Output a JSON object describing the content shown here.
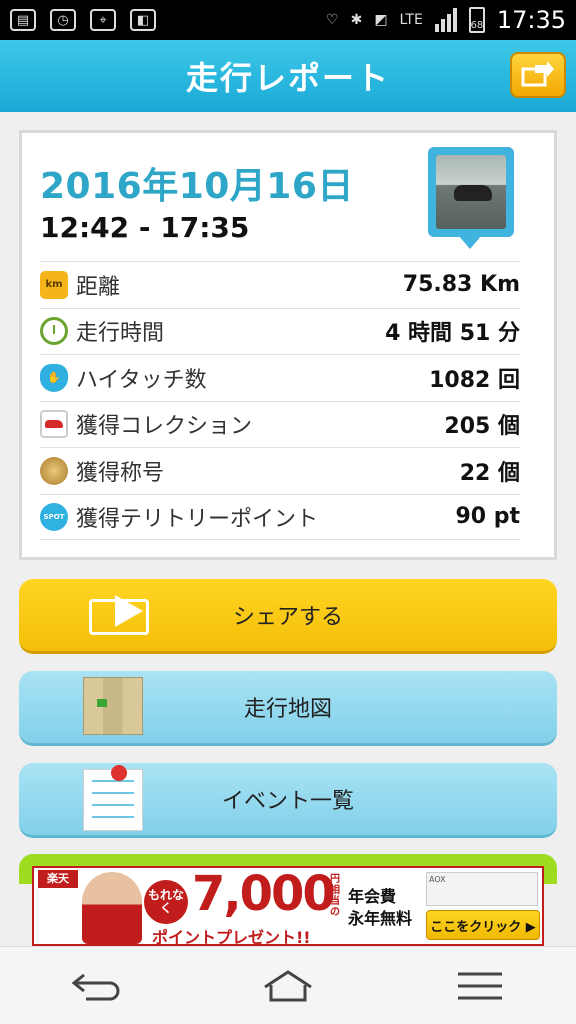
{
  "status_bar": {
    "network": "LTE",
    "battery": "68",
    "time": "17:35"
  },
  "header": {
    "title": "走行レポート"
  },
  "report": {
    "date": "2016年10月16日",
    "time_range": "12:42 - 17:35",
    "rows": [
      {
        "icon": "km-icon",
        "icon_text": "km",
        "label": "距離",
        "value": "75.83 Km"
      },
      {
        "icon": "clock-icon",
        "label": "走行時間",
        "value": "4 時間 51 分"
      },
      {
        "icon": "hand-icon",
        "label": "ハイタッチ数",
        "value": "1082 回"
      },
      {
        "icon": "car-icon",
        "label": "獲得コレクション",
        "value": "205 個"
      },
      {
        "icon": "medal-icon",
        "label": "獲得称号",
        "value": "22 個"
      },
      {
        "icon": "spot-icon",
        "icon_text": "SPOT",
        "label": "獲得テリトリーポイント",
        "value": "90 pt"
      }
    ]
  },
  "buttons": {
    "share": "シェアする",
    "map": "走行地図",
    "events": "イベント一覧"
  },
  "ad": {
    "brand": "楽天",
    "badge": "もれなく",
    "amount": "7,000",
    "unit": "円相当の",
    "sub": "ポイントプレゼント!!",
    "fee_line1": "年会費",
    "fee_line2": "永年無料",
    "cards_label": "AOX",
    "cta": "ここをクリック ▶"
  },
  "colors": {
    "header": "#1aa9d6",
    "date": "#2ea6c8",
    "share_button": "#f4be08",
    "nav_button": "#82d0ea"
  }
}
